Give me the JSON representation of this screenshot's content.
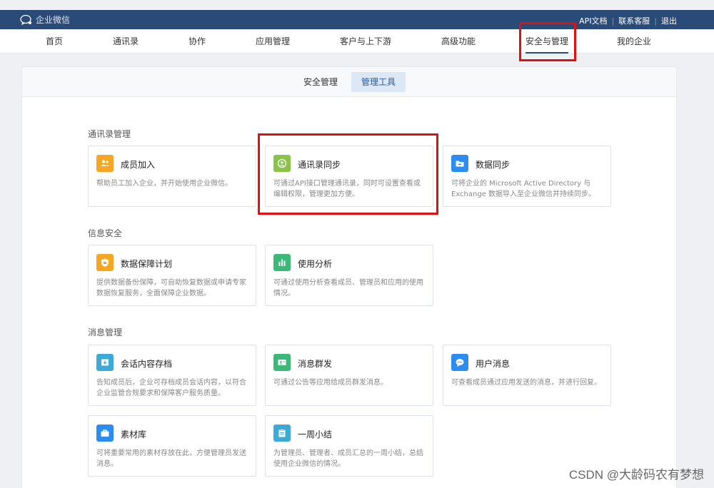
{
  "topbar": {
    "logo_text": "企业微信",
    "links": [
      "API文档",
      "联系客服",
      "退出"
    ],
    "separator": "|"
  },
  "nav": {
    "items": [
      "首页",
      "通讯录",
      "协作",
      "应用管理",
      "客户与上下游",
      "高级功能",
      "安全与管理",
      "我的企业"
    ],
    "active": "安全与管理"
  },
  "subtabs": {
    "items": [
      "安全管理",
      "管理工具"
    ],
    "active": "管理工具"
  },
  "sections": [
    {
      "title": "通讯录管理",
      "cards": [
        {
          "title": "成员加入",
          "desc": "帮助员工加入企业，并开始使用企业微信。",
          "icon": "users-icon",
          "color": "#f5a623"
        },
        {
          "title": "通讯录同步",
          "desc": "可通过API接口管理通讯录，同时可设置查看或编辑权限，管理更加方便。",
          "icon": "contact-sync-icon",
          "color": "#8bc34a"
        },
        {
          "title": "数据同步",
          "desc": "可将企业的 Microsoft Active Directory 与 Exchange 数据导入至企业微信并持续同步。",
          "icon": "folder-sync-icon",
          "color": "#2d8cf0"
        }
      ]
    },
    {
      "title": "信息安全",
      "cards": [
        {
          "title": "数据保障计划",
          "desc": "提供数据备份保障，可自助恢复数据或申请专家数据恢复服务，全面保障企业数据。",
          "icon": "shield-icon",
          "color": "#f5a623"
        },
        {
          "title": "使用分析",
          "desc": "可通过使用分析查看成员、管理员和应用的使用情况。",
          "icon": "bar-chart-icon",
          "color": "#3cb878"
        }
      ]
    },
    {
      "title": "消息管理",
      "cards": [
        {
          "title": "会话内容存档",
          "desc": "告知成员后，企业可存档成员会话内容，以符合企业监管合规要求和保障客户服务质量。",
          "icon": "archive-icon",
          "color": "#3da9d6"
        },
        {
          "title": "消息群发",
          "desc": "可通过公告等应用给成员群发消息。",
          "icon": "broadcast-icon",
          "color": "#3cb878"
        },
        {
          "title": "用户消息",
          "desc": "可查看成员通过应用发送的消息，并进行回复。",
          "icon": "chat-icon",
          "color": "#2d8cf0"
        },
        {
          "title": "素材库",
          "desc": "可将重要常用的素材存放在此，方便管理员发送消息。",
          "icon": "briefcase-icon",
          "color": "#2d8cf0"
        },
        {
          "title": "一周小结",
          "desc": "为管理员、管理者、成员汇总的一周小结，总结使用企业微信的情况。",
          "icon": "clipboard-icon",
          "color": "#3da9d6"
        }
      ]
    }
  ],
  "watermark": "CSDN @大龄码农有梦想"
}
